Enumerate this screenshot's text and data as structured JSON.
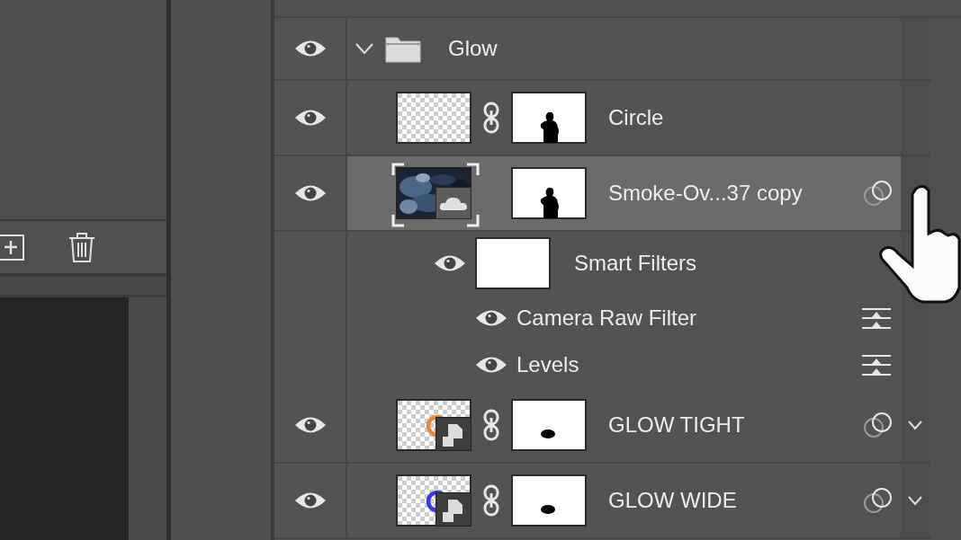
{
  "left_panel": {
    "tools": [
      {
        "kind": "new"
      },
      {
        "kind": "delete"
      }
    ]
  },
  "layers": [
    {
      "kind": "group",
      "name": "Glow",
      "visible": true,
      "expanded": true,
      "children": [
        {
          "kind": "layer",
          "name": "Circle",
          "visible": true,
          "selected": false,
          "thumbnail": {
            "kind": "transparent"
          },
          "linked": true,
          "mask": {
            "kind": "figure"
          },
          "blend_icon": false,
          "chevron": false
        },
        {
          "kind": "layer",
          "name": "Smoke-Ov...37 copy",
          "visible": true,
          "selected": true,
          "thumbnail": {
            "kind": "smart-picture"
          },
          "linked": false,
          "mask": {
            "kind": "figure"
          },
          "blend_icon": true,
          "children": [
            {
              "kind": "smart_filters",
              "name": "Smart Filters",
              "visible": true,
              "children": [
                {
                  "kind": "filter",
                  "name": "Camera Raw Filter",
                  "visible": true
                },
                {
                  "kind": "filter",
                  "name": "Levels",
                  "visible": true
                }
              ]
            }
          ]
        },
        {
          "kind": "layer",
          "name": "GLOW TIGHT",
          "visible": true,
          "selected": false,
          "thumbnail": {
            "kind": "glow"
          },
          "color": "#e8893a",
          "linked": true,
          "mask": {
            "kind": "dot"
          },
          "blend_icon": true,
          "chevron": true
        },
        {
          "kind": "layer",
          "name": "GLOW WIDE",
          "visible": true,
          "selected": false,
          "thumbnail": {
            "kind": "glow"
          },
          "color": "#3a38e0",
          "linked": true,
          "mask": {
            "kind": "dot"
          },
          "blend_icon": true,
          "chevron": true
        }
      ]
    }
  ]
}
